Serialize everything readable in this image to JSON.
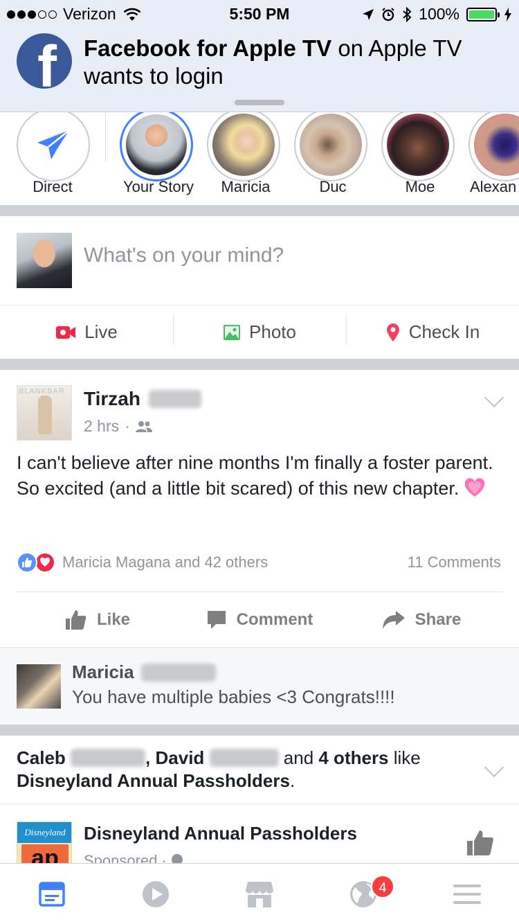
{
  "status_bar": {
    "carrier": "Verizon",
    "time": "5:50 PM",
    "battery": "100%",
    "signal_bars_filled": 3,
    "signal_bars_total": 5
  },
  "notification": {
    "app_bold": "Facebook for Apple TV",
    "suffix": " on Apple TV wants to login"
  },
  "stories": [
    {
      "label": "Direct",
      "icon": "paper-plane-icon"
    },
    {
      "label": "Your Story"
    },
    {
      "label": "Maricia"
    },
    {
      "label": "Duc"
    },
    {
      "label": "Moe"
    },
    {
      "label": "Alexan"
    }
  ],
  "composer": {
    "placeholder": "What's on your mind?",
    "actions": [
      {
        "label": "Live",
        "icon": "live-video-icon",
        "color": "#f02849"
      },
      {
        "label": "Photo",
        "icon": "photo-icon",
        "color": "#45bd62"
      },
      {
        "label": "Check In",
        "icon": "location-pin-icon",
        "color": "#f3425f"
      }
    ]
  },
  "post": {
    "author": "Tirzah",
    "time": "2 hrs",
    "avatar_caption": "BLANKBAR",
    "text": "I can't believe after nine months I'm finally a foster parent. So excited (and a little bit scared) of this new chapter.",
    "reactions": "Maricia Magana and 42 others",
    "comments_count": "11 Comments",
    "actions": {
      "like": "Like",
      "comment": "Comment",
      "share": "Share"
    }
  },
  "comment_preview": {
    "author": "Maricia",
    "text": "You have multiple babies <3 Congrats!!!!"
  },
  "sponsored": {
    "social_name1": "Caleb",
    "social_name2": "David",
    "social_and": " and ",
    "social_others": "4 others",
    "social_like": " like",
    "social_page": "Disneyland Annual Passholders",
    "social_end": ".",
    "page_name": "Disneyland Annual Passholders",
    "meta": "Sponsored · ",
    "avatar_top": "Disneyland",
    "avatar_mark": "ap"
  },
  "tabbar": {
    "notifications_badge": "4",
    "accent": "#4080ff",
    "inactive": "#bec2c9"
  }
}
